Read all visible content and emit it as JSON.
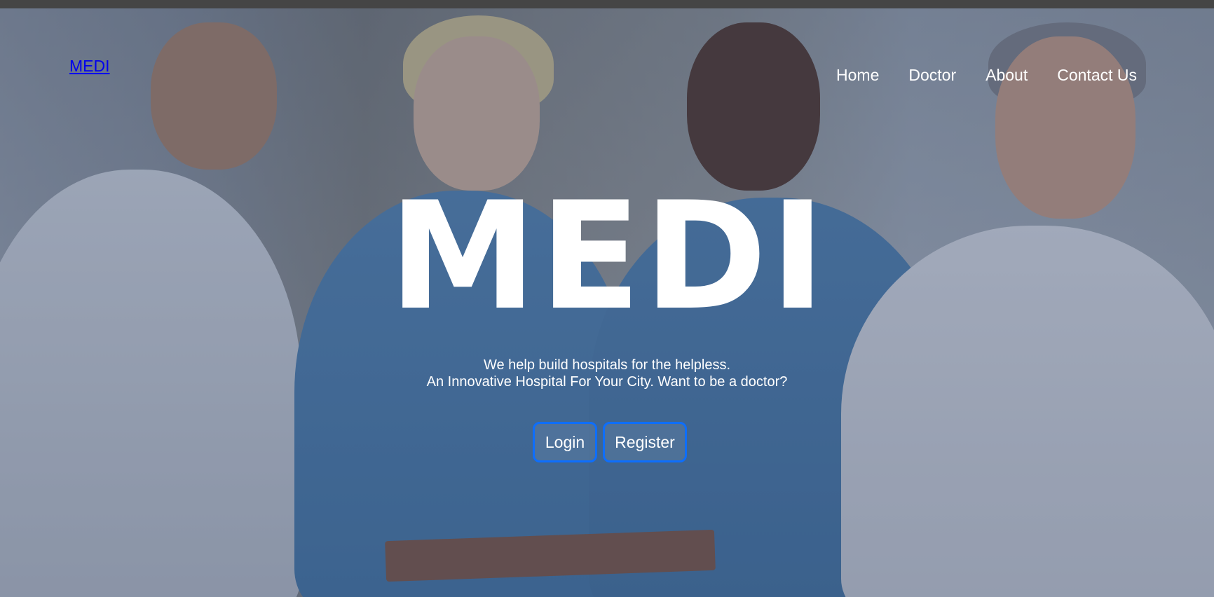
{
  "header": {
    "brand": "MEDI",
    "nav": [
      {
        "label": "Home"
      },
      {
        "label": "Doctor"
      },
      {
        "label": "About"
      },
      {
        "label": "Contact Us"
      }
    ]
  },
  "hero": {
    "title": "MEDI",
    "tagline_line1": "We help build hospitals for the helpless.",
    "tagline_line2": "An Innovative Hospital For Your City. Want to be a doctor?",
    "buttons": {
      "login": "Login",
      "register": "Register"
    },
    "background_image_subject": "four medical professionals"
  },
  "colors": {
    "button_border": "#0d6efd",
    "brand_link": "#0000ee",
    "overlay": "#23375f"
  }
}
